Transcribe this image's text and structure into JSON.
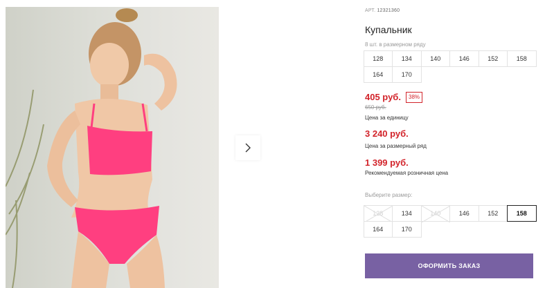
{
  "product": {
    "article_label": "АРТ.",
    "article_value": "12321360",
    "title": "Купальник"
  },
  "size_row": {
    "note": "8 шт. в размерном ряду",
    "sizes": [
      "128",
      "134",
      "140",
      "146",
      "152",
      "158",
      "164",
      "170"
    ]
  },
  "pricing": {
    "unit_price": "405 руб.",
    "discount": "38%",
    "old_price": "650 руб.",
    "unit_caption": "Цена за единицу",
    "row_price": "3 240 руб.",
    "row_caption": "Цена за размерный ряд",
    "retail_price": "1 399 руб.",
    "retail_caption": "Рекомендуемая розничная цена"
  },
  "size_select": {
    "label": "Выберите размер:",
    "sizes": [
      {
        "label": "128",
        "state": "disabled"
      },
      {
        "label": "134",
        "state": "available"
      },
      {
        "label": "140",
        "state": "disabled"
      },
      {
        "label": "146",
        "state": "available"
      },
      {
        "label": "152",
        "state": "available"
      },
      {
        "label": "158",
        "state": "selected"
      },
      {
        "label": "164",
        "state": "available"
      },
      {
        "label": "170",
        "state": "available"
      }
    ]
  },
  "order_button": {
    "label": "ОФОРМИТЬ ЗАКАЗ"
  },
  "gallery": {
    "next_icon": "chevron-right-icon"
  },
  "colors": {
    "price_red": "#d2232a",
    "order_purple": "#7861a3",
    "swimsuit_pink": "#ff3f80"
  }
}
